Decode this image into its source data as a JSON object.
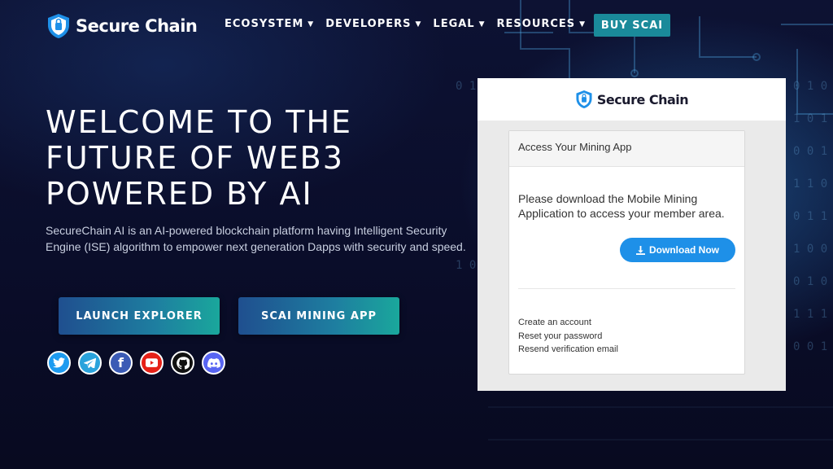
{
  "brand": {
    "name": "Secure Chain"
  },
  "nav": {
    "items": [
      {
        "label": "ECOSYSTEM"
      },
      {
        "label": "DEVELOPERS"
      },
      {
        "label": "LEGAL"
      },
      {
        "label": "RESOURCES"
      }
    ],
    "buy_label": "BUY SCAI"
  },
  "hero": {
    "title_lines": [
      "WELCOME TO THE",
      "FUTURE OF WEB3",
      "POWERED BY AI"
    ],
    "description": "SecureChain AI is an AI-powered blockchain platform having Intelligent Security Engine (ISE) algorithm to empower next generation Dapps with security and speed.",
    "buttons": {
      "explorer": "LAUNCH EXPLORER",
      "mining": "SCAI MINING APP"
    }
  },
  "socials": [
    "twitter-icon",
    "telegram-icon",
    "facebook-icon",
    "youtube-icon",
    "github-icon",
    "discord-icon"
  ],
  "modal": {
    "brand": "Secure Chain",
    "card_title": "Access Your Mining App",
    "message": "Please download the Mobile Mining Application to access your member area.",
    "download_label": "Download Now",
    "links": [
      "Create an account",
      "Reset your password",
      "Resend verification email"
    ]
  },
  "colors": {
    "accent": "#1e90e8",
    "buy": "#1a8a9a",
    "bg": "#0b0f2a"
  }
}
